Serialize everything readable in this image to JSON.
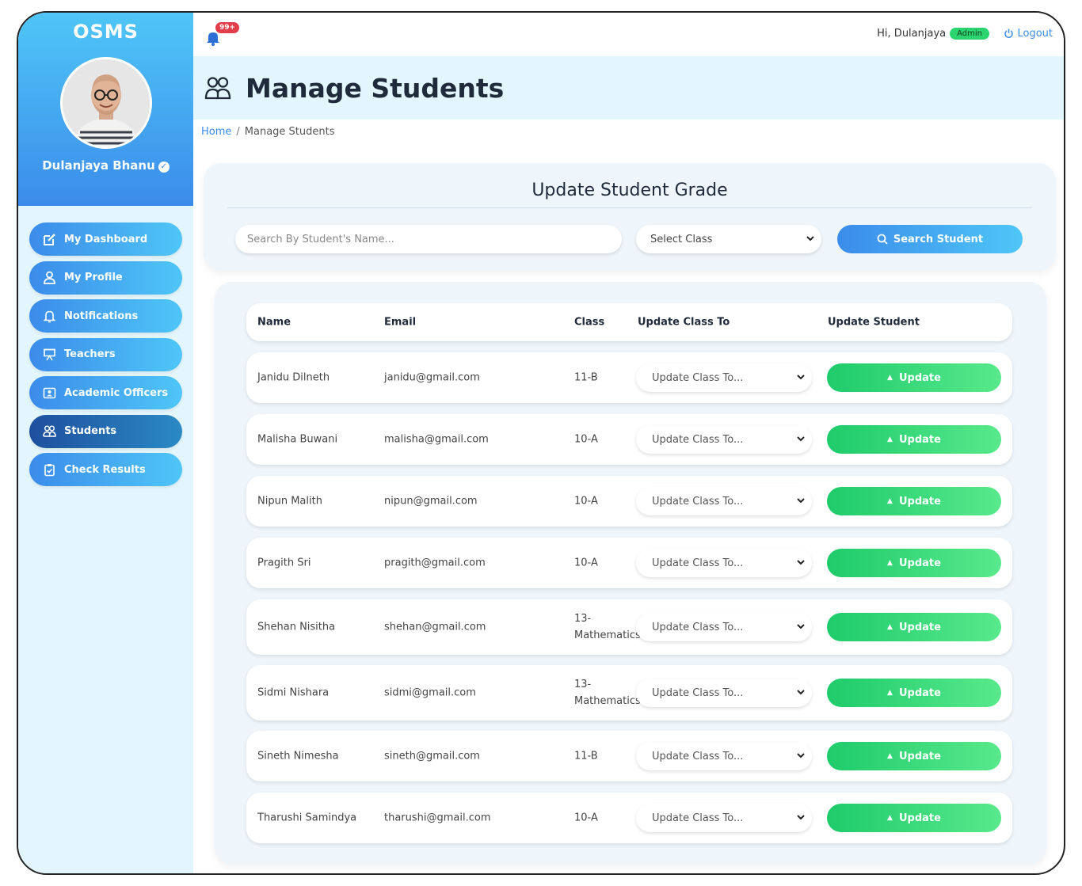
{
  "sidebar": {
    "logo": "OSMS",
    "username": "Dulanjaya Bhanu",
    "items": [
      {
        "label": "My Dashboard",
        "icon": "edit-icon"
      },
      {
        "label": "My Profile",
        "icon": "user-icon"
      },
      {
        "label": "Notifications",
        "icon": "bell-icon"
      },
      {
        "label": "Teachers",
        "icon": "presentation-icon"
      },
      {
        "label": "Academic Officers",
        "icon": "id-card-icon"
      },
      {
        "label": "Students",
        "icon": "users-icon",
        "active": true
      },
      {
        "label": "Check Results",
        "icon": "clipboard-check-icon"
      }
    ]
  },
  "topbar": {
    "notification_badge": "99+",
    "greeting": "Hi, Dulanjaya",
    "role_badge": "Admin",
    "logout": "Logout"
  },
  "page": {
    "title": "Manage Students",
    "breadcrumb_home": "Home",
    "breadcrumb_sep": "/",
    "breadcrumb_current": "Manage Students"
  },
  "search_card": {
    "title": "Update Student Grade",
    "search_placeholder": "Search By Student's Name...",
    "class_select": "Select Class",
    "search_button": "Search Student"
  },
  "table": {
    "headers": [
      "Name",
      "Email",
      "Class",
      "Update Class To",
      "Update Student"
    ],
    "select_placeholder": "Update Class To...",
    "button_label": "Update",
    "rows": [
      {
        "name": "Janidu Dilneth",
        "email": "janidu@gmail.com",
        "class": "11-B"
      },
      {
        "name": "Malisha Buwani",
        "email": "malisha@gmail.com",
        "class": "10-A"
      },
      {
        "name": "Nipun Malith",
        "email": "nipun@gmail.com",
        "class": "10-A"
      },
      {
        "name": "Pragith Sri",
        "email": "pragith@gmail.com",
        "class": "10-A"
      },
      {
        "name": "Shehan Nisitha",
        "email": "shehan@gmail.com",
        "class": "13-Mathematics"
      },
      {
        "name": "Sidmi Nishara",
        "email": "sidmi@gmail.com",
        "class": "13-Mathematics"
      },
      {
        "name": "Sineth Nimesha",
        "email": "sineth@gmail.com",
        "class": "11-B"
      },
      {
        "name": "Tharushi Samindya",
        "email": "tharushi@gmail.com",
        "class": "10-A"
      }
    ]
  },
  "colors": {
    "primary": "#3b8cea",
    "accent": "#4fc6f7",
    "success": "#1ecb6a",
    "active_nav": "#1e4f9e",
    "badge": "#e23d4a"
  }
}
